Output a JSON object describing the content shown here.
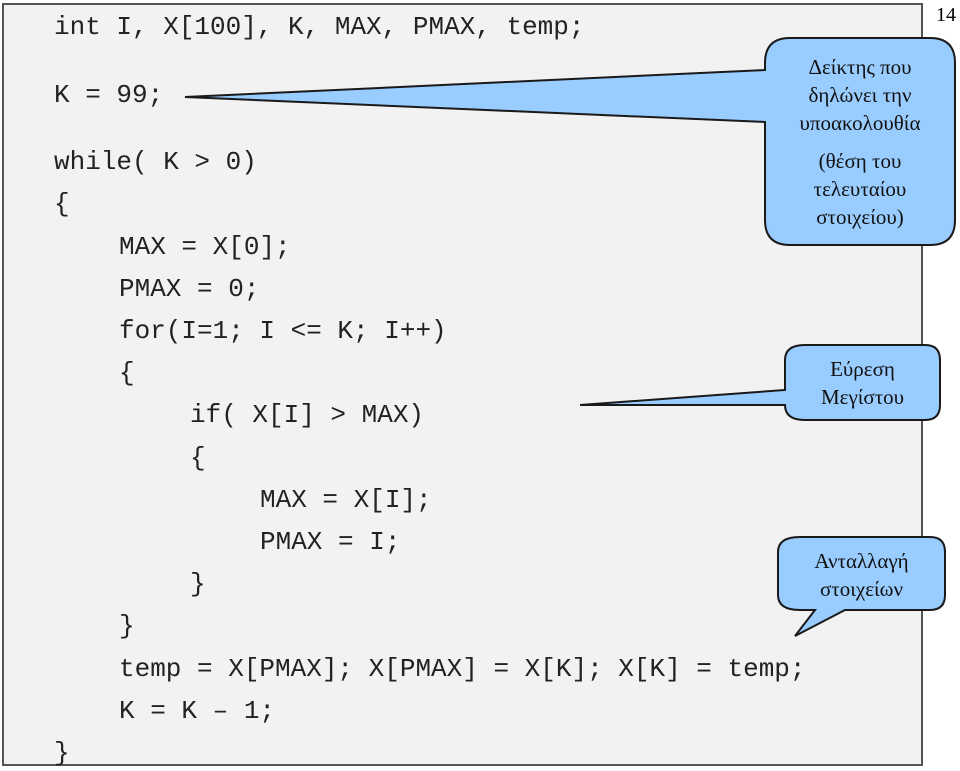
{
  "page_number": "14",
  "code_lines": [
    "int I, X[100], K, MAX, PMAX, temp;",
    "K = 99;",
    "while( K > 0)",
    "{",
    "MAX = X[0];",
    "PMAX = 0;",
    "for(I=1; I <= K; I++)",
    "{",
    "if( X[I] > MAX)",
    "{",
    "MAX = X[I];",
    "PMAX = I;",
    "}",
    "}",
    "temp = X[PMAX]; X[PMAX] = X[K]; X[K] = temp;",
    "K = K – 1;",
    "}"
  ],
  "callouts": {
    "index_pointer": {
      "lines": [
        "Δείκτης που",
        "δηλώνει την",
        "υποακολουθία"
      ],
      "sub_lines": [
        "(θέση του",
        "τελευταίου",
        "στοιχείου)"
      ]
    },
    "find_max": {
      "lines": [
        "Εύρεση",
        "Μεγίστου"
      ]
    },
    "swap": {
      "lines": [
        "Ανταλλαγή",
        "στοιχείων"
      ]
    }
  },
  "colors": {
    "callout_fill": "#99ccff",
    "box_bg": "#f2f2f2"
  }
}
